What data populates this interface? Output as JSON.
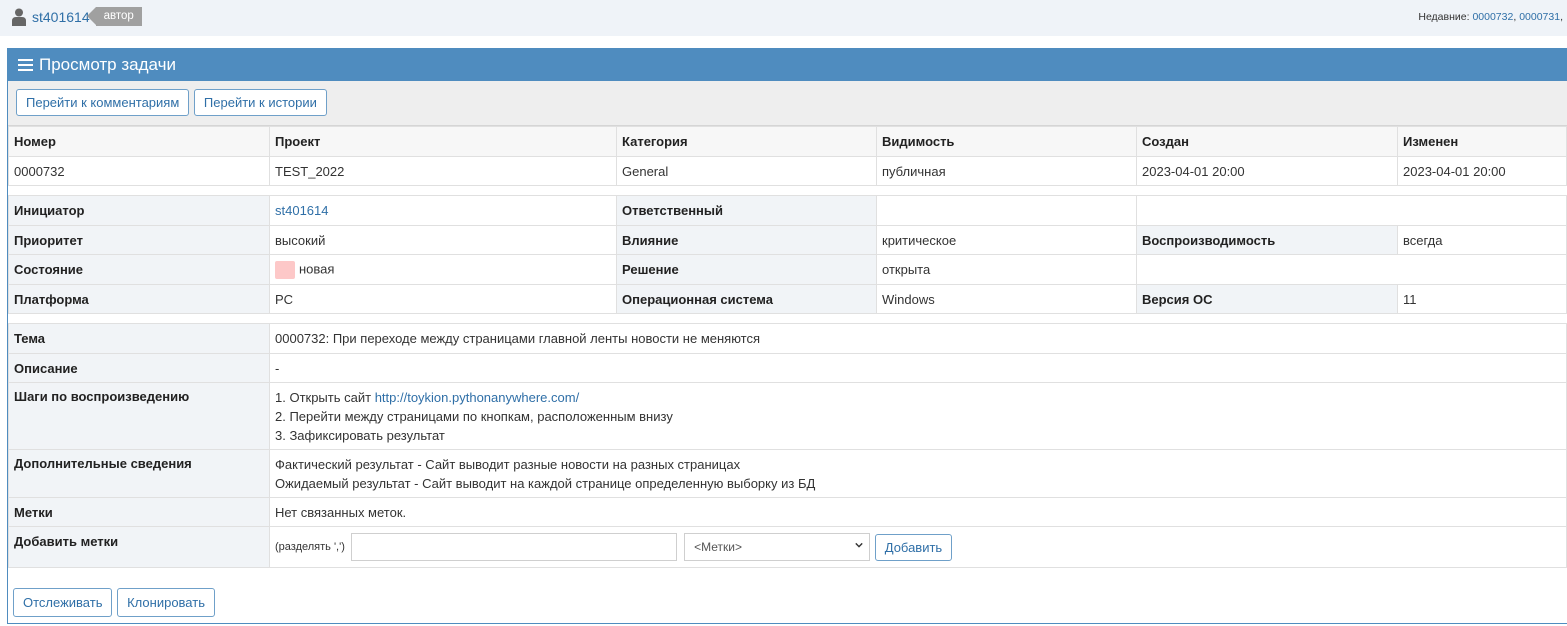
{
  "topbar": {
    "username": "st401614",
    "role": "автор",
    "recent_label": "Недавние:",
    "recent_links": [
      "0000732",
      "0000731"
    ]
  },
  "page": {
    "title": "Просмотр задачи",
    "buttons": {
      "to_comments": "Перейти к комментариям",
      "to_history": "Перейти к истории"
    }
  },
  "summary": {
    "headers": [
      "Номер",
      "Проект",
      "Категория",
      "Видимость",
      "Создан",
      "Изменен"
    ],
    "values": [
      "0000732",
      "TEST_2022",
      "General",
      "публичная",
      "2023-04-01 20:00",
      "2023-04-01 20:00"
    ]
  },
  "details": {
    "reporter_label": "Инициатор",
    "reporter": "st401614",
    "handler_label": "Ответственный",
    "handler": "",
    "priority_label": "Приоритет",
    "priority": "высокий",
    "severity_label": "Влияние",
    "severity": "критическое",
    "reproducibility_label": "Воспроизводимость",
    "reproducibility": "всегда",
    "status_label": "Состояние",
    "status": "новая",
    "status_color": "#fdc8c8",
    "resolution_label": "Решение",
    "resolution": "открыта",
    "platform_label": "Платформа",
    "platform": "PC",
    "os_label": "Операционная система",
    "os": "Windows",
    "os_version_label": "Версия ОС",
    "os_version": "11"
  },
  "description": {
    "summary_label": "Тема",
    "summary": "0000732: При переходе между страницами главной ленты новости не меняются",
    "description_label": "Описание",
    "description": "-",
    "steps_label": "Шаги по воспроизведению",
    "steps_1_prefix": "1. Открыть сайт ",
    "steps_1_link": "http://toykion.pythonanywhere.com/",
    "steps_2": "2. Перейти между страницами по кнопкам, расположенным внизу",
    "steps_3": "3. Зафиксировать результат",
    "additional_label": "Дополнительные сведения",
    "additional_1": "Фактический результат - Сайт выводит разные новости на разных страницах",
    "additional_2": "Ожидаемый результат - Сайт выводит на каждой странице определенную выборку из БД",
    "tags_label": "Метки",
    "tags": "Нет связанных меток.",
    "add_tags_label": "Добавить метки",
    "add_tags_hint": "(разделять ',')",
    "tags_select": "<Метки>",
    "add_button": "Добавить"
  },
  "footer": {
    "watch": "Отслеживать",
    "clone": "Клонировать"
  },
  "colors": {
    "header": "#4f8cbf",
    "link": "#2f6fa7",
    "label_bg": "#f1f4f7"
  }
}
